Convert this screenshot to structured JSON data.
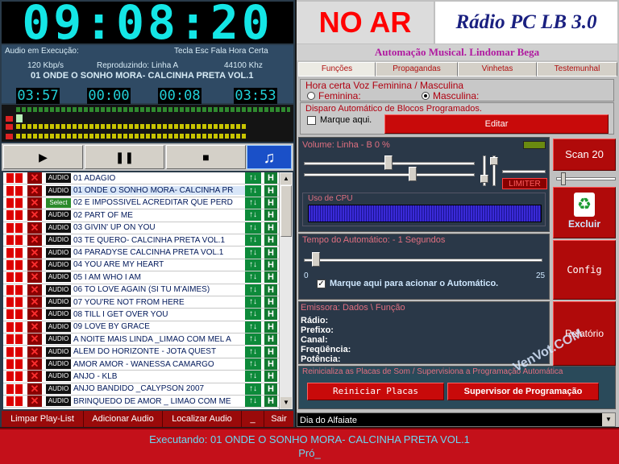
{
  "clock": "09:08:20",
  "left": {
    "audio_label": "Audio em Execução:",
    "hotkey_label": "Tecla Esc Fala Hora Certa",
    "bitrate": "120 Kbp/s",
    "playing_label": "Reproduzindo: Linha A",
    "samplerate": "44100 Khz",
    "current_song": "01 ONDE O SONHO MORA- CALCINHA PRETA VOL.1",
    "timers": [
      "03:57",
      "00:00",
      "00:08",
      "03:53"
    ]
  },
  "transport": {
    "play": "▶",
    "pause": "❚❚",
    "stop": "■",
    "media": "♫"
  },
  "playlist": {
    "items": [
      {
        "tag": "AUDIO",
        "title": "01 ADAGIO"
      },
      {
        "tag": "AUDIO",
        "title": "01 ONDE O SONHO MORA- CALCINHA PR"
      },
      {
        "tag": "Select",
        "title": "02 E IMPOSSIVEL ACREDITAR QUE PERD"
      },
      {
        "tag": "AUDIO",
        "title": "02 PART OF ME"
      },
      {
        "tag": "AUDIO",
        "title": "03 GIVIN' UP ON YOU"
      },
      {
        "tag": "AUDIO",
        "title": "03 TE QUERO- CALCINHA PRETA VOL.1"
      },
      {
        "tag": "AUDIO",
        "title": "04 PARADYSE CALCINHA PRETA VOL.1"
      },
      {
        "tag": "AUDIO",
        "title": "04 YOU ARE MY HEART"
      },
      {
        "tag": "AUDIO",
        "title": "05 I AM WHO I AM"
      },
      {
        "tag": "AUDIO",
        "title": "06 TO LOVE AGAIN (SI TU M'AIMES)"
      },
      {
        "tag": "AUDIO",
        "title": "07 YOU'RE NOT FROM HERE"
      },
      {
        "tag": "AUDIO",
        "title": "08 TILL I GET OVER YOU"
      },
      {
        "tag": "AUDIO",
        "title": "09 LOVE BY GRACE"
      },
      {
        "tag": "AUDIO",
        "title": "A NOITE MAIS LINDA _LIMÃO COM MEL A"
      },
      {
        "tag": "AUDIO",
        "title": "ALÉM DO HORIZONTE - JOTA QUEST"
      },
      {
        "tag": "AUDIO",
        "title": "AMOR AMOR - WANESSA CAMARGO"
      },
      {
        "tag": "AUDIO",
        "title": "ANJO - KLB"
      },
      {
        "tag": "AUDIO",
        "title": "ANJO BANDIDO _CALYPSON 2007"
      },
      {
        "tag": "AUDIO",
        "title": "BRINQUEDO DE AMOR _ LIMÃO COM ME"
      }
    ],
    "move_glyph": "↑↓",
    "h_glyph": "H",
    "x_glyph": "✕"
  },
  "playlist_buttons": [
    "Limpar Play-List",
    "Adicionar Audio",
    "Localizar Audio",
    "_",
    "Sair"
  ],
  "header": {
    "onair": "NO AR",
    "brand": "Rádio PC LB 3.0",
    "subtitle": "Automação Musical. Lindomar Bega"
  },
  "tabs": [
    "Funções",
    "Propagandas",
    "Vinhetas",
    "Testemunhal"
  ],
  "funcoes": {
    "hora_certa_label": "Hora certa Voz Feminina / Masculina",
    "feminina": "Feminina:",
    "masculina": "Masculina:",
    "disparo_label": "Disparo Automático de Blocos Programados.",
    "marque": "Marque aqui.",
    "editar": "Editar"
  },
  "volume": {
    "label": "Volume: Linha -  B 0 %",
    "limiter": "LIMITER",
    "cpu_label": "Uso de CPU"
  },
  "scan_button": "Scan 20",
  "excluir_button": "Excluir",
  "config_button": "Config",
  "relatorio_button": "Relatório",
  "auto": {
    "label": "Tempo do Automático: - 1 Segundos",
    "min": "0",
    "max": "25",
    "checkbox_label": "Marque aqui para acionar o Automático."
  },
  "emissora": {
    "label": "Emissora: Dados \\ Função",
    "lines": [
      "Rádio:",
      "Prefixo:",
      "Canal:",
      "Freqüência:",
      "Potência:"
    ]
  },
  "reinicia": {
    "label": "Reinicializa as Placas de Som / Supervisiona a Programação Automática",
    "reiniciar": "Reiniciar Placas",
    "supervisor": "Supervisor de Programação"
  },
  "day_select": "Dia do Alfaiate",
  "status": {
    "line1": "Executando: 01 ONDE O SONHO MORA- CALCINHA PRETA VOL.1",
    "line2": "Pró_"
  },
  "watermark": "VenVot.COM"
}
